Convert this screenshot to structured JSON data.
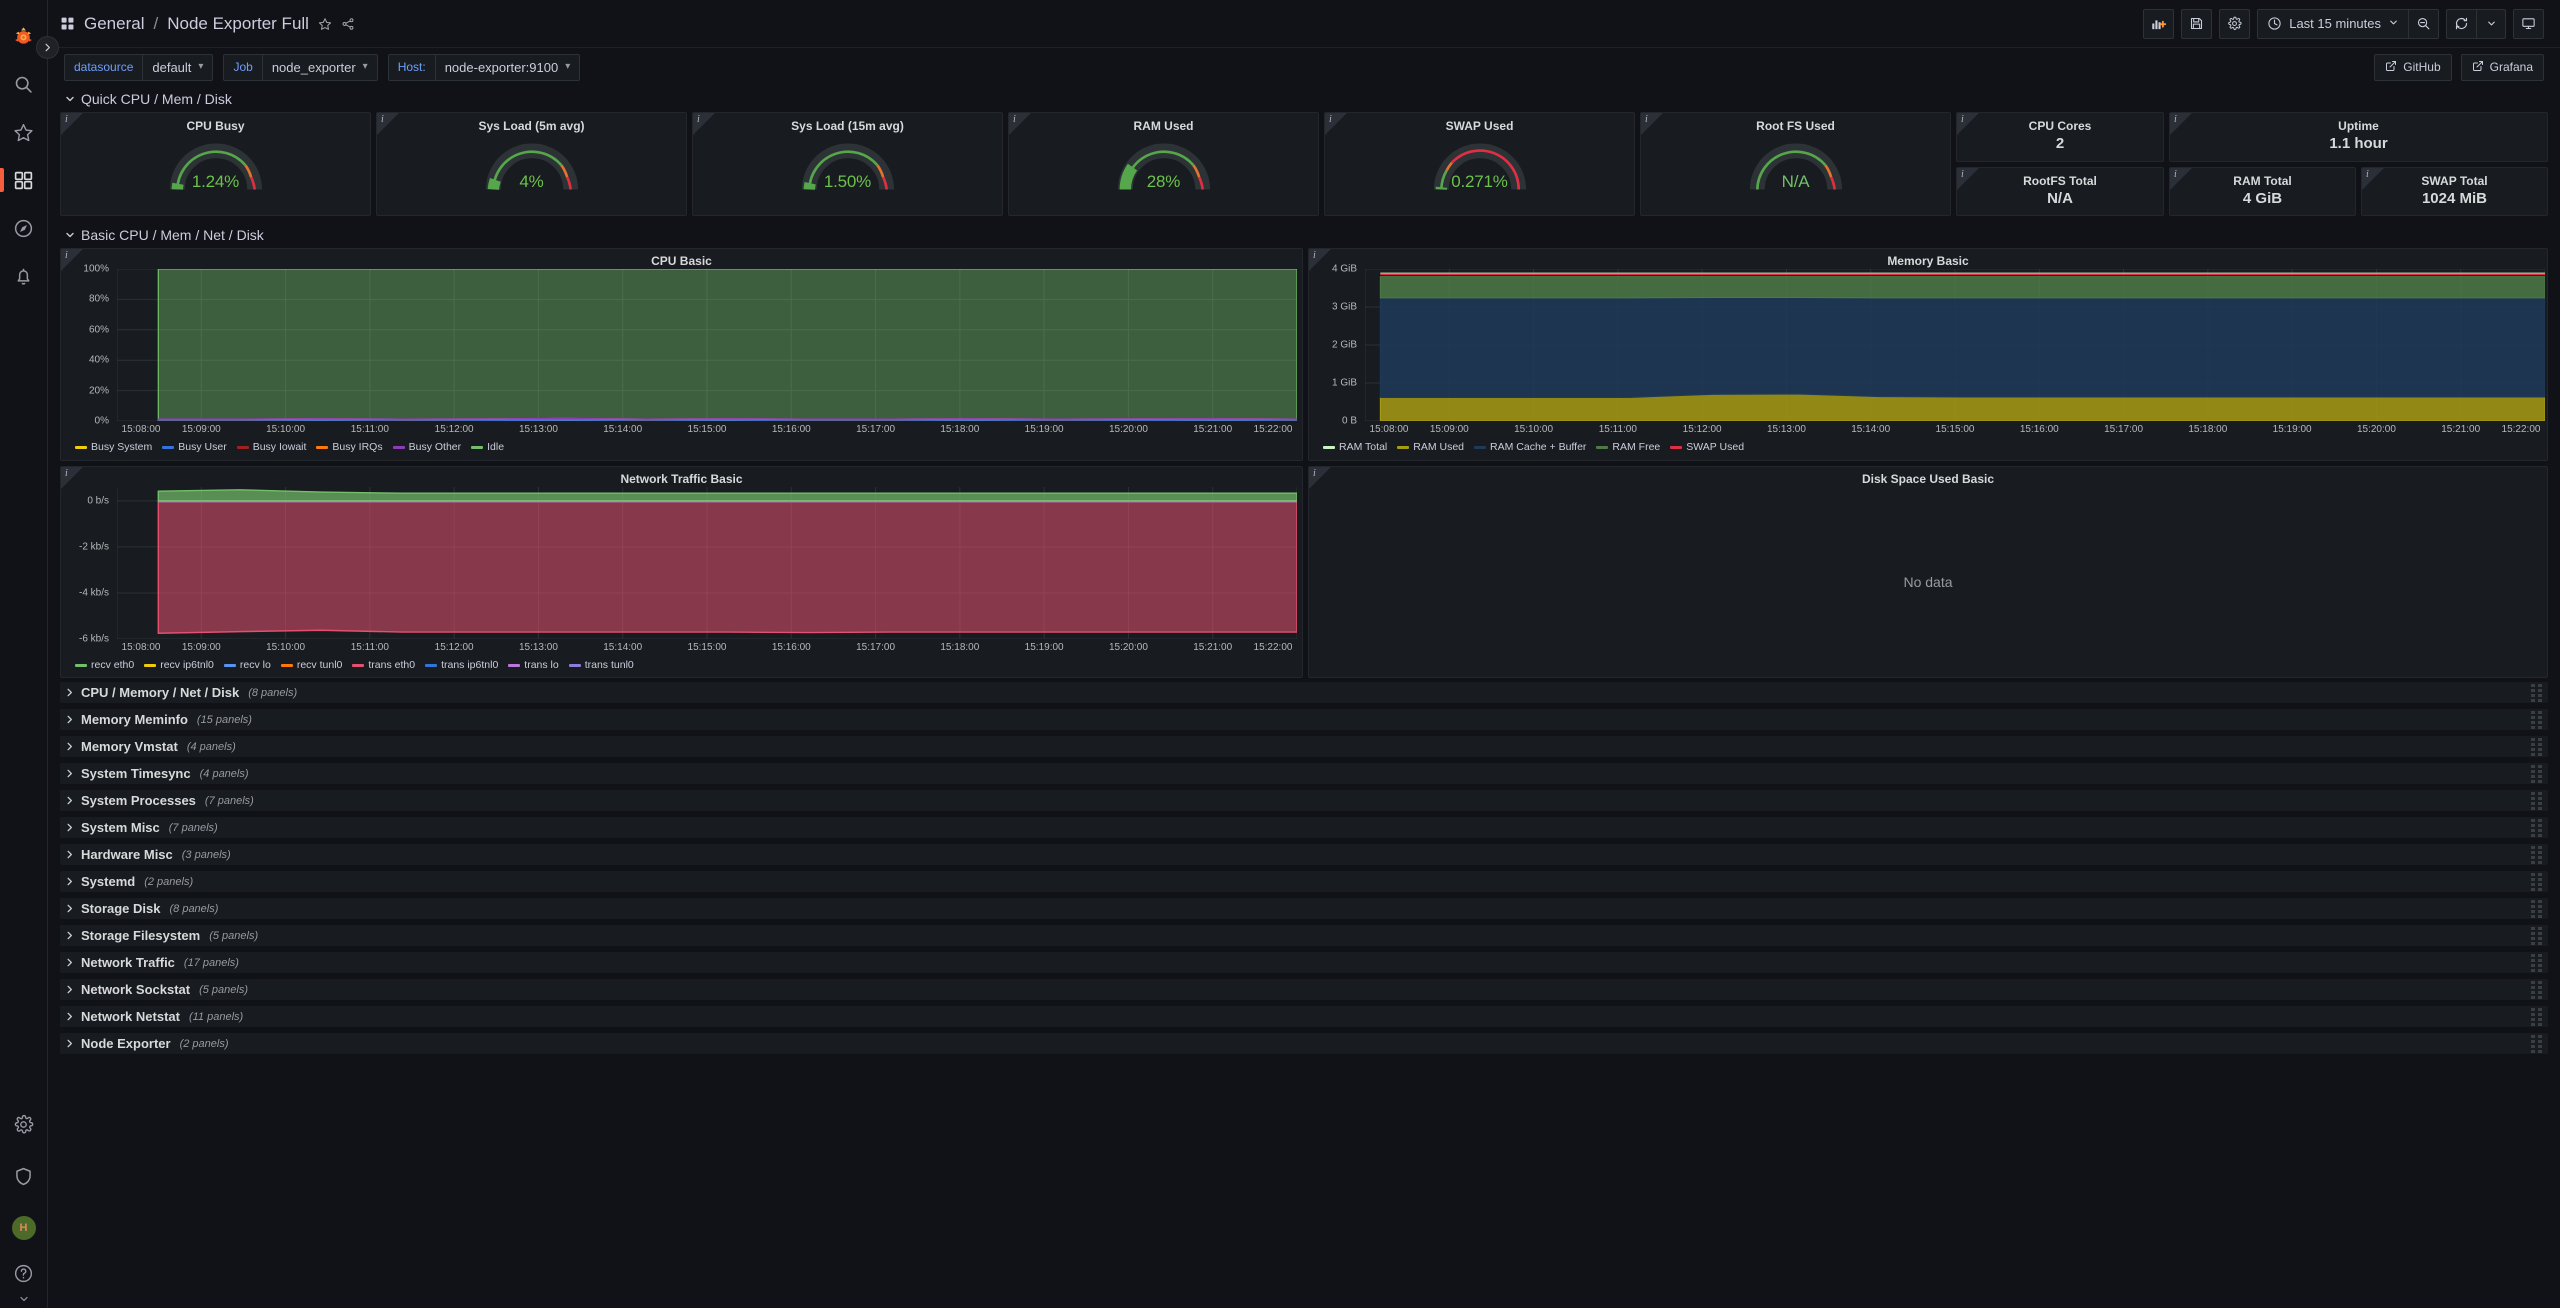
{
  "sidenav": {
    "items": [
      {
        "name": "grafana-logo-icon",
        "label": "Grafana"
      },
      {
        "name": "search-icon",
        "label": "Search"
      },
      {
        "name": "starred-icon",
        "label": "Starred"
      },
      {
        "name": "dashboards-icon",
        "label": "Dashboards"
      },
      {
        "name": "explore-compass-icon",
        "label": "Explore"
      },
      {
        "name": "alerting-bell-icon",
        "label": "Alerting"
      }
    ],
    "bottom_items": [
      {
        "name": "configuration-gear-icon",
        "label": "Configuration"
      },
      {
        "name": "server-admin-shield-icon",
        "label": "Server Admin"
      },
      {
        "name": "user-avatar",
        "label": "H"
      },
      {
        "name": "help-question-icon",
        "label": "Help"
      }
    ],
    "expand_label": "Expand navigation"
  },
  "topbar": {
    "folder": "General",
    "separator": "/",
    "title": "Node Exporter Full",
    "star_label": "Mark as favorite",
    "share_label": "Share dashboard",
    "buttons": [
      {
        "name": "add-panel-button",
        "label": "Add panel"
      },
      {
        "name": "save-dashboard-button",
        "label": "Save dashboard"
      },
      {
        "name": "dashboard-settings-button",
        "label": "Dashboard settings"
      }
    ],
    "time_range": "Last 15 minutes",
    "zoom_out_label": "Zoom out time range",
    "refresh_label": "Refresh dashboard",
    "refresh_interval_label": "Auto refresh interval",
    "tv_mode_label": "Cycle view mode"
  },
  "variables": [
    {
      "label": "datasource",
      "value": "default"
    },
    {
      "label": "Job",
      "value": "node_exporter"
    },
    {
      "label": "Host:",
      "value": "node-exporter:9100"
    }
  ],
  "dashboard_links": [
    {
      "label": "GitHub"
    },
    {
      "label": "Grafana"
    }
  ],
  "rows": {
    "quick": {
      "title": "Quick CPU / Mem / Disk",
      "collapsed": false
    },
    "basic": {
      "title": "Basic CPU / Mem / Net / Disk",
      "collapsed": false
    }
  },
  "gauges": [
    {
      "title": "CPU Busy",
      "value": "1.24%",
      "percent": 1.24,
      "threshold_style": "green-amber-red"
    },
    {
      "title": "Sys Load (5m avg)",
      "value": "4%",
      "percent": 4,
      "threshold_style": "green-amber-red"
    },
    {
      "title": "Sys Load (15m avg)",
      "value": "1.50%",
      "percent": 1.5,
      "threshold_style": "green-amber-red"
    },
    {
      "title": "RAM Used",
      "value": "28%",
      "percent": 28,
      "threshold_style": "green-amber-red"
    },
    {
      "title": "SWAP Used",
      "value": "0.271%",
      "percent": 0.271,
      "threshold_style": "red-amber-green"
    },
    {
      "title": "Root FS Used",
      "value": "N/A",
      "percent": 0,
      "threshold_style": "green-amber-red"
    }
  ],
  "stats": [
    {
      "title": "CPU Cores",
      "value": "2"
    },
    {
      "title": "Uptime",
      "value": "1.1 hour"
    },
    {
      "title": "RootFS Total",
      "value": "N/A"
    },
    {
      "title": "RAM Total",
      "value": "4 GiB"
    },
    {
      "title": "SWAP Total",
      "value": "1024 MiB"
    }
  ],
  "chart_data": [
    {
      "type": "area",
      "panel": "cpu-basic",
      "title": "CPU Basic",
      "xlabel": "",
      "ylabel": "",
      "ylim": [
        0,
        100
      ],
      "yticks": [
        "0%",
        "20%",
        "40%",
        "60%",
        "80%",
        "100%"
      ],
      "ytick_values": [
        0,
        20,
        40,
        60,
        80,
        100
      ],
      "xticks": [
        "15:08:00",
        "15:09:00",
        "15:10:00",
        "15:11:00",
        "15:12:00",
        "15:13:00",
        "15:14:00",
        "15:15:00",
        "15:16:00",
        "15:17:00",
        "15:18:00",
        "15:19:00",
        "15:20:00",
        "15:21:00",
        "15:22:00"
      ],
      "grid": true,
      "legend_position": "bottom",
      "stacked": true,
      "series": [
        {
          "name": "Busy System",
          "color": "#f2cc0c",
          "values": [
            0.4,
            0.4,
            0.5,
            0.4,
            0.4,
            0.5,
            0.4,
            0.5,
            0.4,
            0.4,
            0.5,
            0.4,
            0.4,
            0.5,
            0.4
          ]
        },
        {
          "name": "Busy User",
          "color": "#3274d9",
          "values": [
            0.5,
            0.5,
            0.6,
            0.5,
            0.6,
            0.7,
            0.5,
            0.6,
            0.5,
            0.5,
            0.6,
            0.5,
            0.6,
            0.6,
            0.5
          ]
        },
        {
          "name": "Busy Iowait",
          "color": "#a02020",
          "values": [
            0.1,
            0.1,
            0.1,
            0.1,
            0.1,
            0.1,
            0.1,
            0.1,
            0.1,
            0.1,
            0.1,
            0.1,
            0.1,
            0.1,
            0.1
          ]
        },
        {
          "name": "Busy IRQs",
          "color": "#ff780a",
          "values": [
            0.2,
            0.2,
            0.2,
            0.2,
            0.2,
            0.3,
            0.2,
            0.2,
            0.2,
            0.2,
            0.2,
            0.2,
            0.2,
            0.2,
            0.2
          ]
        },
        {
          "name": "Busy Other",
          "color": "#8f3bb8",
          "values": [
            0.05,
            0.05,
            0.05,
            0.05,
            0.05,
            0.05,
            0.05,
            0.05,
            0.05,
            0.05,
            0.05,
            0.05,
            0.05,
            0.05,
            0.05
          ]
        },
        {
          "name": "Idle",
          "color": "#73bf69",
          "values": [
            98.7,
            98.7,
            98.5,
            98.7,
            98.6,
            98.3,
            98.7,
            98.5,
            98.7,
            98.7,
            98.5,
            98.7,
            98.6,
            98.5,
            98.7
          ]
        }
      ]
    },
    {
      "type": "area",
      "panel": "memory-basic",
      "title": "Memory Basic",
      "xlabel": "",
      "ylabel": "",
      "ylim": [
        0,
        4
      ],
      "yticks": [
        "0 B",
        "1 GiB",
        "2 GiB",
        "3 GiB",
        "4 GiB"
      ],
      "ytick_values": [
        0,
        1,
        2,
        3,
        4
      ],
      "xticks": [
        "15:08:00",
        "15:09:00",
        "15:10:00",
        "15:11:00",
        "15:12:00",
        "15:13:00",
        "15:14:00",
        "15:15:00",
        "15:16:00",
        "15:17:00",
        "15:18:00",
        "15:19:00",
        "15:20:00",
        "15:21:00",
        "15:22:00"
      ],
      "grid": true,
      "legend_position": "bottom",
      "stacked": true,
      "series": [
        {
          "name": "RAM Total",
          "color": "#c8f2c2",
          "values": [
            3.86,
            3.86,
            3.86,
            3.86,
            3.86,
            3.86,
            3.86,
            3.86,
            3.86,
            3.86,
            3.86,
            3.86,
            3.86,
            3.86,
            3.86
          ]
        },
        {
          "name": "RAM Used",
          "color": "#a89b14",
          "values": [
            0.62,
            0.62,
            0.62,
            0.62,
            0.7,
            0.71,
            0.64,
            0.63,
            0.63,
            0.63,
            0.63,
            0.63,
            0.63,
            0.63,
            0.63
          ]
        },
        {
          "name": "RAM Cache + Buffer",
          "color": "#1f3a5a",
          "values": [
            2.62,
            2.62,
            2.62,
            2.62,
            2.55,
            2.54,
            2.6,
            2.61,
            2.61,
            2.61,
            2.61,
            2.61,
            2.61,
            2.61,
            2.61
          ]
        },
        {
          "name": "RAM Free",
          "color": "#4d7a46",
          "values": [
            0.56,
            0.56,
            0.56,
            0.56,
            0.55,
            0.55,
            0.56,
            0.56,
            0.56,
            0.56,
            0.56,
            0.56,
            0.56,
            0.56,
            0.56
          ]
        },
        {
          "name": "SWAP Used",
          "color": "#e02f44",
          "values": [
            0.06,
            0.06,
            0.06,
            0.06,
            0.06,
            0.06,
            0.06,
            0.06,
            0.06,
            0.06,
            0.06,
            0.06,
            0.06,
            0.06,
            0.06
          ]
        }
      ]
    },
    {
      "type": "area",
      "panel": "network-traffic-basic",
      "title": "Network Traffic Basic",
      "xlabel": "",
      "ylabel": "",
      "ylim": [
        -6,
        0.6
      ],
      "yticks": [
        "0 b/s",
        "-2 kb/s",
        "-4 kb/s",
        "-6 kb/s"
      ],
      "ytick_values": [
        0,
        -2,
        -4,
        -6
      ],
      "xticks": [
        "15:08:00",
        "15:09:00",
        "15:10:00",
        "15:11:00",
        "15:12:00",
        "15:13:00",
        "15:14:00",
        "15:15:00",
        "15:16:00",
        "15:17:00",
        "15:18:00",
        "15:19:00",
        "15:20:00",
        "15:21:00",
        "15:22:00"
      ],
      "grid": true,
      "legend_position": "bottom",
      "series": [
        {
          "name": "recv eth0",
          "color": "#73bf69",
          "values": [
            0.42,
            0.48,
            0.38,
            0.33,
            0.33,
            0.33,
            0.33,
            0.33,
            0.33,
            0.33,
            0.33,
            0.33,
            0.33,
            0.33,
            0.33
          ]
        },
        {
          "name": "recv ip6tnl0",
          "color": "#f2cc0c",
          "values": [
            0,
            0,
            0,
            0,
            0,
            0,
            0,
            0,
            0,
            0,
            0,
            0,
            0,
            0,
            0
          ]
        },
        {
          "name": "recv lo",
          "color": "#5794f2",
          "values": [
            0,
            0,
            0,
            0,
            0,
            0,
            0,
            0,
            0,
            0,
            0,
            0,
            0,
            0,
            0
          ]
        },
        {
          "name": "recv tunl0",
          "color": "#ff780a",
          "values": [
            0,
            0,
            0,
            0,
            0,
            0,
            0,
            0,
            0,
            0,
            0,
            0,
            0,
            0,
            0
          ]
        },
        {
          "name": "trans eth0",
          "color": "#e5506f",
          "values": [
            -5.75,
            -5.68,
            -5.62,
            -5.7,
            -5.7,
            -5.7,
            -5.7,
            -5.7,
            -5.72,
            -5.7,
            -5.7,
            -5.7,
            -5.7,
            -5.7,
            -5.7
          ]
        },
        {
          "name": "trans ip6tnl0",
          "color": "#3274d9",
          "values": [
            0,
            0,
            0,
            0,
            0,
            0,
            0,
            0,
            0,
            0,
            0,
            0,
            0,
            0,
            0
          ]
        },
        {
          "name": "trans lo",
          "color": "#b877d9",
          "values": [
            -0.04,
            -0.04,
            -0.04,
            -0.04,
            -0.04,
            -0.04,
            -0.04,
            -0.04,
            -0.04,
            -0.04,
            -0.04,
            -0.04,
            -0.04,
            -0.04,
            -0.04
          ]
        },
        {
          "name": "trans tunl0",
          "color": "#8f7bd9",
          "values": [
            0,
            0,
            0,
            0,
            0,
            0,
            0,
            0,
            0,
            0,
            0,
            0,
            0,
            0,
            0
          ]
        }
      ]
    },
    {
      "type": "area",
      "panel": "disk-space-used-basic",
      "title": "Disk Space Used Basic",
      "no_data_text": "No data",
      "series": []
    }
  ],
  "collapsed_rows": [
    {
      "title": "CPU / Memory / Net / Disk",
      "panels": "(8 panels)"
    },
    {
      "title": "Memory Meminfo",
      "panels": "(15 panels)"
    },
    {
      "title": "Memory Vmstat",
      "panels": "(4 panels)"
    },
    {
      "title": "System Timesync",
      "panels": "(4 panels)"
    },
    {
      "title": "System Processes",
      "panels": "(7 panels)"
    },
    {
      "title": "System Misc",
      "panels": "(7 panels)"
    },
    {
      "title": "Hardware Misc",
      "panels": "(3 panels)"
    },
    {
      "title": "Systemd",
      "panels": "(2 panels)"
    },
    {
      "title": "Storage Disk",
      "panels": "(8 panels)"
    },
    {
      "title": "Storage Filesystem",
      "panels": "(5 panels)"
    },
    {
      "title": "Network Traffic",
      "panels": "(17 panels)"
    },
    {
      "title": "Network Sockstat",
      "panels": "(5 panels)"
    },
    {
      "title": "Network Netstat",
      "panels": "(11 panels)"
    },
    {
      "title": "Node Exporter",
      "panels": "(2 panels)"
    }
  ],
  "colors": {
    "accent": "#f55f3e",
    "panel_bg": "#181b1f",
    "page_bg": "#111217",
    "green": "#73bf69",
    "link_blue": "#6e9fff"
  }
}
